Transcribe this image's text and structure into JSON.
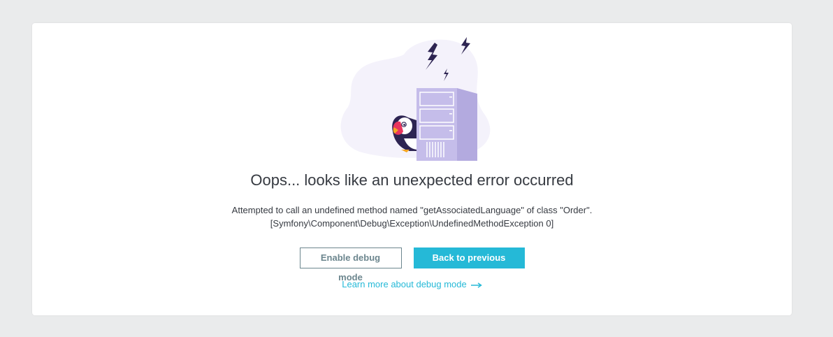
{
  "error": {
    "title": "Oops... looks like an unexpected error occurred",
    "message_line1": "Attempted to call an undefined method named \"getAssociatedLanguage\" of class \"Order\".",
    "message_line2": "[Symfony\\Component\\Debug\\Exception\\UndefinedMethodException 0]"
  },
  "actions": {
    "enable_debug_label": "Enable debug mode",
    "back_label": "Back to previous page",
    "learn_more_label": "Learn more about debug mode"
  },
  "colors": {
    "primary": "#25b9d7",
    "outline": "#6c868e",
    "text": "#363a41",
    "illustration_purple": "#c5bdea",
    "bolt": "#2d2452"
  },
  "icons": {
    "learn_more_arrow": "arrow-right-icon"
  }
}
